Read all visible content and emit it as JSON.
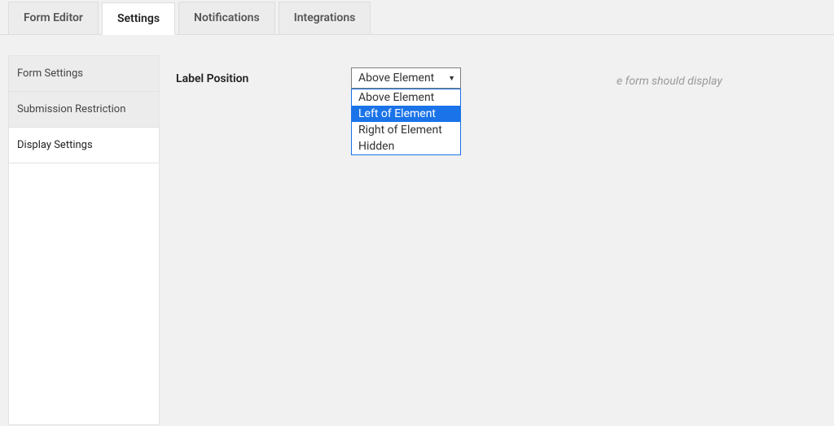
{
  "tabs": {
    "form_editor": "Form Editor",
    "settings": "Settings",
    "notifications": "Notifications",
    "integrations": "Integrations"
  },
  "sidebar": {
    "form_settings": "Form Settings",
    "submission_restriction": "Submission Restriction",
    "display_settings": "Display Settings"
  },
  "field": {
    "label": "Label Position",
    "selected": "Above Element",
    "help_visible": "e form should display"
  },
  "dropdown": {
    "option_0": "Above Element",
    "option_1": "Left of Element",
    "option_2": "Right of Element",
    "option_3": "Hidden"
  }
}
